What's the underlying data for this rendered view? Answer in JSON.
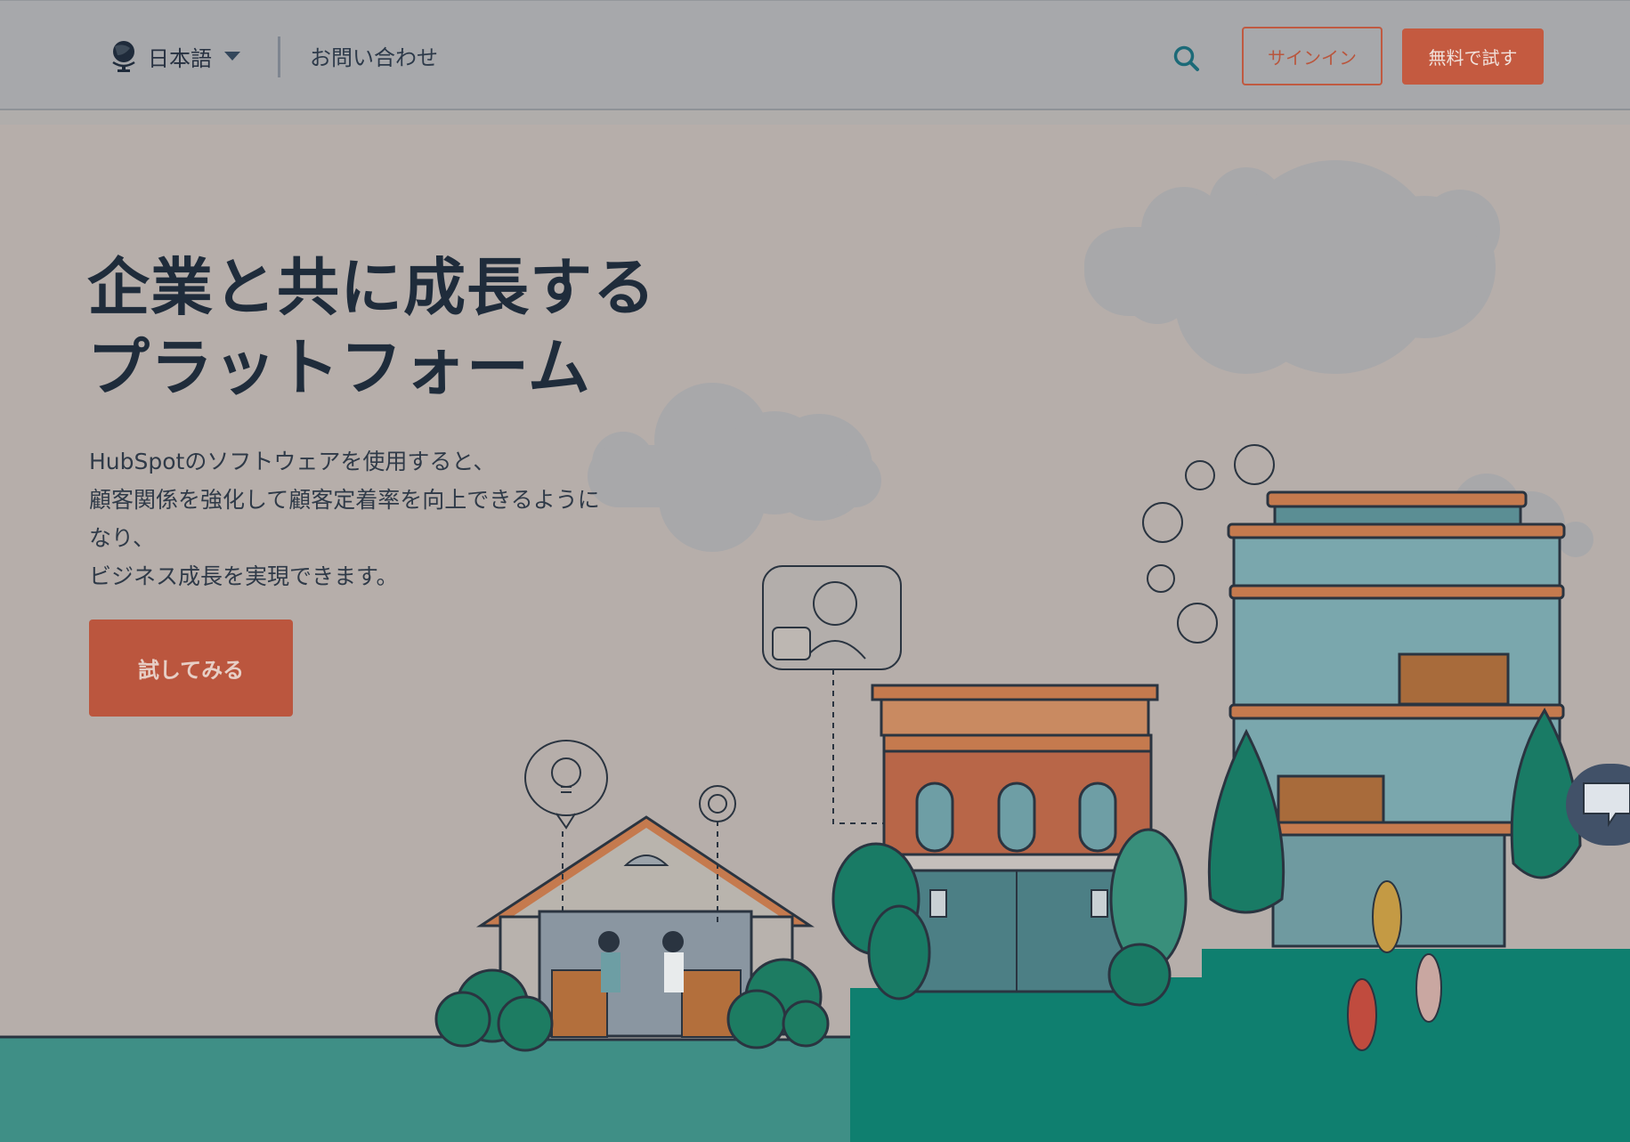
{
  "header": {
    "language_label": "日本語",
    "contact_label": "お問い合わせ",
    "signin_label": "サインイン",
    "trial_label": "無料で試す"
  },
  "hero": {
    "title_lines": [
      "企業と共に成長する",
      "プラットフォーム"
    ],
    "description_lines": [
      "HubSpotのソフトウェアを使用すると、",
      "顧客関係を強化して顧客定着率を向上できるように",
      "なり、",
      "ビジネス成長を実現できます。"
    ],
    "cta_label": "試してみる"
  },
  "colors": {
    "accent": "#c45a40",
    "dark_text": "#1f2c3b",
    "teal": "#00846f",
    "background": "#b6aeaa"
  },
  "icons": {
    "globe": "globe-icon",
    "dropdown": "caret-down-icon",
    "search": "search-icon",
    "chat": "chat-icon"
  }
}
